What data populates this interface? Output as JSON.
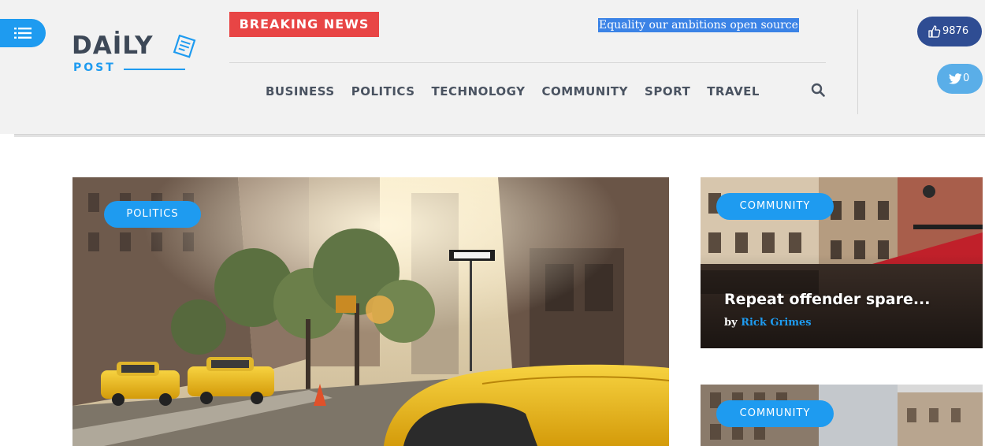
{
  "header": {
    "logo_main": "DAİLY",
    "logo_sub": "POST",
    "breaking_label": "BREAKING NEWS",
    "ticker_text": "Equality our ambitions open source",
    "nav": [
      {
        "label": "BUSINESS"
      },
      {
        "label": "POLITICS"
      },
      {
        "label": "TECHNOLOGY"
      },
      {
        "label": "COMMUNITY"
      },
      {
        "label": "SPORT"
      },
      {
        "label": "TRAVEL"
      }
    ],
    "icons": {
      "menu": "hamburger-icon",
      "search": "search-icon",
      "like": "thumbs-up-icon",
      "twitter": "twitter-icon",
      "logo": "newspaper-icon"
    }
  },
  "social": {
    "likes": "9876",
    "tweets": "0"
  },
  "hero": {
    "category": "POLITICS"
  },
  "side_cards": [
    {
      "category": "COMMUNITY",
      "title": "Repeat offender spare...",
      "by": "by",
      "author": "Rick Grimes"
    },
    {
      "category": "COMMUNITY"
    }
  ],
  "colors": {
    "accent": "#1e9bf0",
    "breaking": "#e84545",
    "facebook": "#2f4d93",
    "twitter": "#5aaee8",
    "header_bg": "#f2f2f2",
    "text_dark": "#4a5361"
  }
}
